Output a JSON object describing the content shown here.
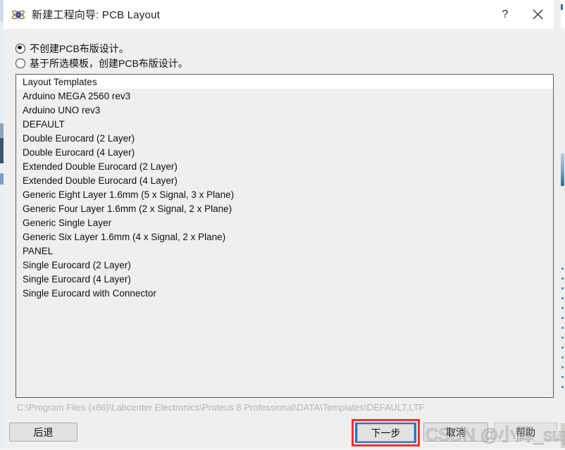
{
  "window": {
    "title": "新建工程向导: PCB Layout",
    "icon": "proteus-atom-icon",
    "help_label": "?",
    "close_label": "✕"
  },
  "options": [
    {
      "label": "不创建PCB布版设计。",
      "checked": true
    },
    {
      "label": "基于所选模板，创建PCB布版设计。",
      "checked": false
    }
  ],
  "list": {
    "header": "Layout Templates",
    "items": [
      "Arduino MEGA 2560 rev3",
      "Arduino UNO rev3",
      "DEFAULT",
      "Double Eurocard (2 Layer)",
      "Double Eurocard (4 Layer)",
      "Extended Double Eurocard (2 Layer)",
      "Extended Double Eurocard (4 Layer)",
      "Generic Eight Layer 1.6mm (5 x Signal, 3 x Plane)",
      "Generic Four Layer 1.6mm (2 x Signal, 2 x Plane)",
      "Generic Single Layer",
      "Generic Six Layer 1.6mm (4 x Signal, 2 x Plane)",
      "PANEL",
      "Single Eurocard (2 Layer)",
      "Single Eurocard (4 Layer)",
      "Single Eurocard with Connector"
    ]
  },
  "status": {
    "path": "C:\\Program Files (x86)\\Labcenter Electronics\\Proteus 8 Professional\\DATA\\Templates\\DEFAULT.LTF"
  },
  "footer": {
    "back_label": "后退",
    "next_label": "下一步",
    "cancel_label": "取消",
    "help_label": "帮助"
  },
  "watermark": {
    "text": "CSDN @小辉_super"
  },
  "colors": {
    "highlight_red": "#f0302e",
    "highlight_blue": "#1878d0",
    "dialog_bg": "#efefef",
    "titlebar_bg": "#ffffff",
    "list_border": "#5a5a5a"
  }
}
